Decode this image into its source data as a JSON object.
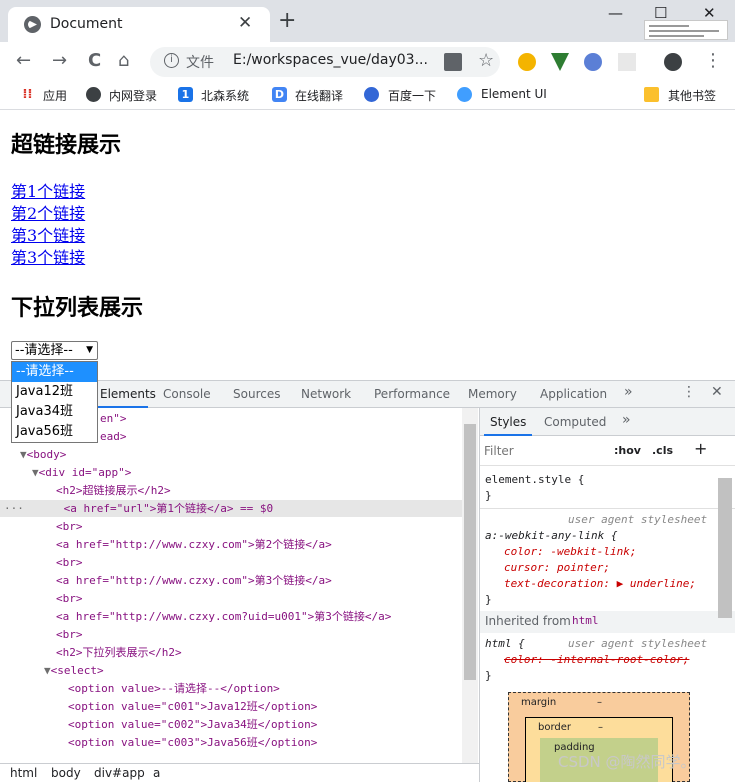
{
  "browser": {
    "tab_title": "Document",
    "tab_close": "✕",
    "new_tab": "+",
    "win_min": "—",
    "win_max": "☐",
    "win_close": "✕",
    "nav_back": "←",
    "nav_forward": "→",
    "nav_reload": "C",
    "nav_home": "⌂",
    "omni_label": "文件",
    "omni_url": "E:/workspaces_vue/day03...",
    "star": "☆",
    "menu": "⋮"
  },
  "bookmarks": {
    "apps": "应用",
    "items": [
      "内网登录",
      "北森系统",
      "在线翻译",
      "百度一下",
      "Element UI"
    ],
    "other": "其他书签"
  },
  "page": {
    "heading1": "超链接展示",
    "links": [
      "第1个链接",
      "第2个链接",
      "第3个链接",
      "第3个链接"
    ],
    "heading2": "下拉列表展示",
    "select_value": "--请选择--",
    "options": [
      "--请选择--",
      "Java12班",
      "Java34班",
      "Java56班"
    ]
  },
  "devtools": {
    "tabs": [
      "Elements",
      "Console",
      "Sources",
      "Network",
      "Performance",
      "Memory",
      "Application"
    ],
    "more": "»",
    "menu": "⋮",
    "close": "✕",
    "elements_lines": [
      "en\">",
      "ead>",
      "<body>",
      "<div id=\"app\">",
      "<h2>超链接展示</h2>",
      "<a href=\"url\">第1个链接</a> == $0",
      "<br>",
      "<a href=\"http://www.czxy.com\">第2个链接</a>",
      "<br>",
      "<a href=\"http://www.czxy.com\">第3个链接</a>",
      "<br>",
      "<a href=\"http://www.czxy.com?uid=u001\">第3个链接</a>",
      "<br>",
      "<h2>下拉列表展示</h2>",
      "<select>",
      "<option value>--请选择--</option>",
      "<option value=\"c001\">Java12班</option>",
      "<option value=\"c002\">Java34班</option>",
      "<option value=\"c003\">Java56班</option>"
    ],
    "styles": {
      "tabs": [
        "Styles",
        "Computed"
      ],
      "filter_placeholder": "Filter",
      "hov": ":hov",
      "cls": ".cls",
      "plus": "+",
      "element_style": "element.style {",
      "close_brace": "}",
      "rule1_selector": "a:-webkit-any-link {",
      "rule1_source": "user agent stylesheet",
      "rule1_props": [
        "color: -webkit-link;",
        "cursor: pointer;",
        "text-decoration: ▶ underline;"
      ],
      "inherited": "Inherited from",
      "inherited_tag": "html",
      "rule2_selector": "html {",
      "rule2_source": "user agent stylesheet",
      "rule2_prop": "color: -internal-root-color;",
      "box_margin": "margin",
      "box_border": "border",
      "box_padding": "padding",
      "dash": "–"
    },
    "breadcrumbs": [
      "html",
      "body",
      "div#app",
      "a"
    ]
  },
  "watermark": "CSDN @陶然同学。"
}
